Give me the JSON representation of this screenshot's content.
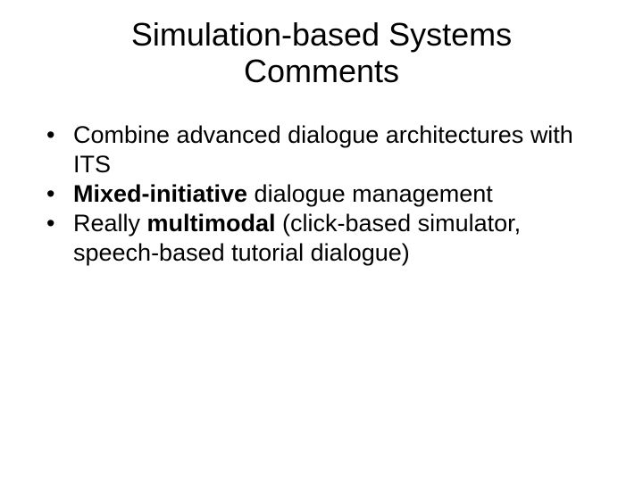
{
  "title_line1": "Simulation-based Systems",
  "title_line2": "Comments",
  "bullets": [
    {
      "pre": "Combine advanced dialogue architectures with ITS",
      "bold": "",
      "post": ""
    },
    {
      "pre": "",
      "bold": "Mixed-initiative",
      "post": " dialogue management"
    },
    {
      "pre": "Really ",
      "bold": "multimodal",
      "post": " (click-based simulator, speech-based tutorial dialogue)"
    }
  ]
}
